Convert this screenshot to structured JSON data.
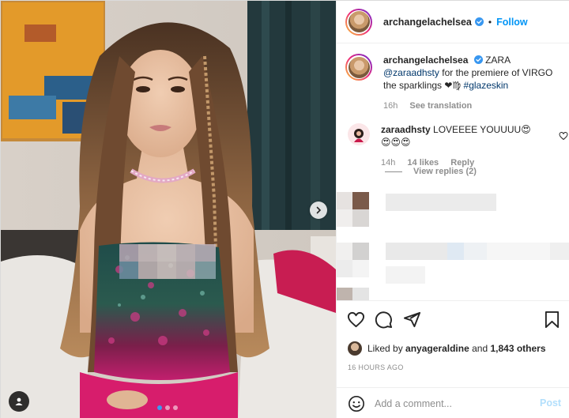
{
  "post": {
    "author": "archangelachelsea",
    "follow_label": "Follow",
    "separator": "•",
    "carousel_count": 3,
    "carousel_active": 1
  },
  "caption": {
    "author": "archangelachelsea",
    "text_1": "ZARA",
    "mention": "@zaraadhsty",
    "text_2": "for the premiere of VIRGO the sparklings ❤♍",
    "hashtag": "#glazeskin",
    "time": "16h",
    "see_translation": "See translation"
  },
  "comment": {
    "author": "zaraadhsty",
    "text": "LOVEEEE YOUUUU😍😍😍😍",
    "time": "14h",
    "likes": "14 likes",
    "reply_label": "Reply",
    "view_replies": "View replies (2)"
  },
  "likes": {
    "prefix": "Liked by",
    "user": "anyageraldine",
    "suffix": "and",
    "others": "1,843 others"
  },
  "timestamp": "16 HOURS AGO",
  "add_comment": {
    "placeholder": "Add a comment...",
    "post_label": "Post"
  },
  "colors": {
    "accent": "#0095f6",
    "post_disabled": "#b2dffc",
    "text": "#262626",
    "muted": "#8e8e8e"
  },
  "icons": [
    "chevron-right-icon",
    "user-tag-icon",
    "verified-badge-icon",
    "heart-icon",
    "comment-icon",
    "share-icon",
    "bookmark-icon",
    "emoji-icon"
  ]
}
